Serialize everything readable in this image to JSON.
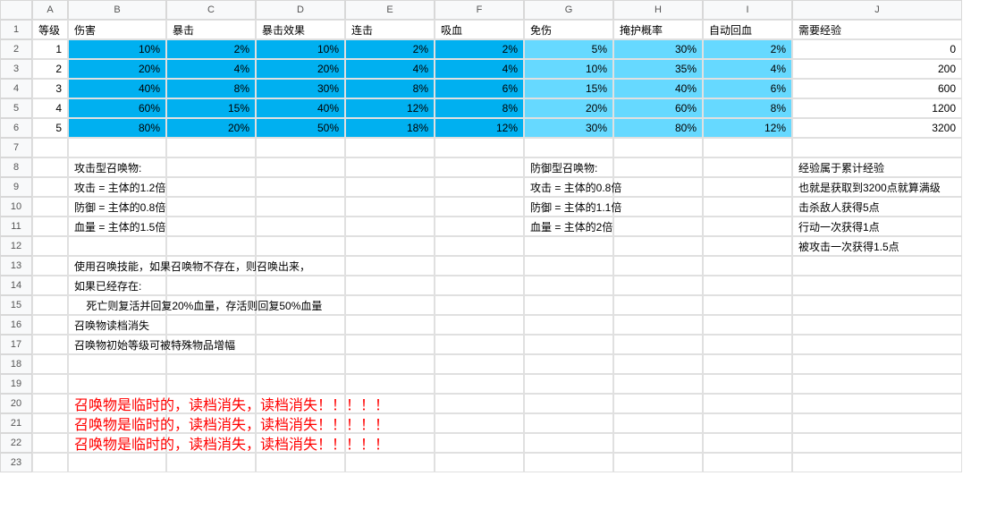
{
  "columns": [
    "A",
    "B",
    "C",
    "D",
    "E",
    "F",
    "G",
    "H",
    "I",
    "J"
  ],
  "row_count": 23,
  "headers": {
    "A": "等级",
    "B": "伤害",
    "C": "暴击",
    "D": "暴击效果",
    "E": "连击",
    "F": "吸血",
    "G": "免伤",
    "H": "掩护概率",
    "I": "自动回血",
    "J": "需要经验"
  },
  "chart_data": {
    "type": "table",
    "columns": [
      "等级",
      "伤害",
      "暴击",
      "暴击效果",
      "连击",
      "吸血",
      "免伤",
      "掩护概率",
      "自动回血",
      "需要经验"
    ],
    "rows": [
      {
        "lvl": "1",
        "B": "10%",
        "C": "2%",
        "D": "10%",
        "E": "2%",
        "F": "2%",
        "G": "5%",
        "H": "30%",
        "I": "2%",
        "J": "0"
      },
      {
        "lvl": "2",
        "B": "20%",
        "C": "4%",
        "D": "20%",
        "E": "4%",
        "F": "4%",
        "G": "10%",
        "H": "35%",
        "I": "4%",
        "J": "200"
      },
      {
        "lvl": "3",
        "B": "40%",
        "C": "8%",
        "D": "30%",
        "E": "8%",
        "F": "6%",
        "G": "15%",
        "H": "40%",
        "I": "6%",
        "J": "600"
      },
      {
        "lvl": "4",
        "B": "60%",
        "C": "15%",
        "D": "40%",
        "E": "12%",
        "F": "8%",
        "G": "20%",
        "H": "60%",
        "I": "8%",
        "J": "1200"
      },
      {
        "lvl": "5",
        "B": "80%",
        "C": "20%",
        "D": "50%",
        "E": "18%",
        "F": "12%",
        "G": "30%",
        "H": "80%",
        "I": "12%",
        "J": "3200"
      }
    ]
  },
  "notes": {
    "atk_title": "攻击型召唤物:",
    "atk_1": "攻击 = 主体的1.2倍",
    "atk_2": "防御 = 主体的0.8倍",
    "atk_3": "血量 = 主体的1.5倍",
    "def_title": "防御型召唤物:",
    "def_1": "攻击 = 主体的0.8倍",
    "def_2": "防御 = 主体的1.1倍",
    "def_3": "血量 = 主体的2倍",
    "exp_1": "经验属于累计经验",
    "exp_2": "也就是获取到3200点就算满级",
    "exp_3": "击杀敌人获得5点",
    "exp_4": "行动一次获得1点",
    "exp_5": "被攻击一次获得1.5点",
    "use_1": "使用召唤技能，如果召唤物不存在，则召唤出来，",
    "use_2": "如果已经存在:",
    "use_3": "    死亡则复活并回复20%血量，存活则回复50%血量",
    "use_4": "召唤物读档消失",
    "use_5": "召唤物初始等级可被特殊物品增幅",
    "warn": "召唤物是临时的，读档消失，读档消失！！！！！"
  }
}
